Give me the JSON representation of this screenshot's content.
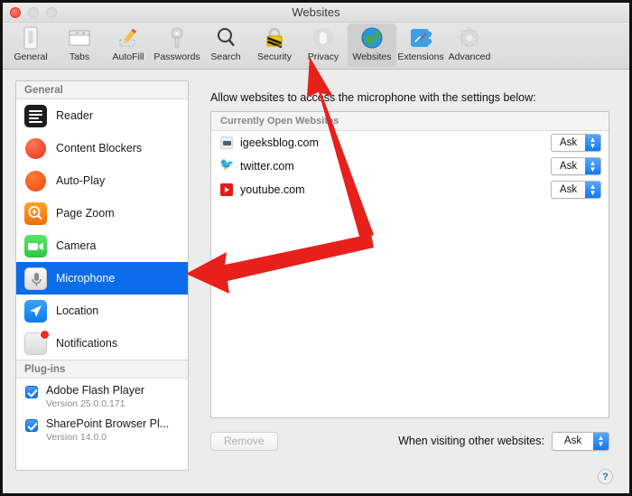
{
  "window": {
    "title": "Websites",
    "traffic_lights": [
      "close",
      "minimize",
      "maximize"
    ]
  },
  "toolbar": {
    "items": [
      {
        "label": "General",
        "icon": "general-icon",
        "selected": false
      },
      {
        "label": "Tabs",
        "icon": "tabs-icon",
        "selected": false
      },
      {
        "label": "AutoFill",
        "icon": "autofill-icon",
        "selected": false
      },
      {
        "label": "Passwords",
        "icon": "passwords-icon",
        "selected": false
      },
      {
        "label": "Search",
        "icon": "search-icon",
        "selected": false
      },
      {
        "label": "Security",
        "icon": "security-icon",
        "selected": false
      },
      {
        "label": "Privacy",
        "icon": "privacy-icon",
        "selected": false
      },
      {
        "label": "Websites",
        "icon": "websites-icon",
        "selected": true
      },
      {
        "label": "Extensions",
        "icon": "extensions-icon",
        "selected": false
      },
      {
        "label": "Advanced",
        "icon": "advanced-icon",
        "selected": false
      }
    ]
  },
  "sidebar": {
    "general_header": "General",
    "items": [
      {
        "label": "Reader",
        "icon": "reader-icon",
        "selected": false
      },
      {
        "label": "Content Blockers",
        "icon": "content-blockers-icon",
        "selected": false
      },
      {
        "label": "Auto-Play",
        "icon": "auto-play-icon",
        "selected": false
      },
      {
        "label": "Page Zoom",
        "icon": "page-zoom-icon",
        "selected": false
      },
      {
        "label": "Camera",
        "icon": "camera-icon",
        "selected": false
      },
      {
        "label": "Microphone",
        "icon": "microphone-icon",
        "selected": true
      },
      {
        "label": "Location",
        "icon": "location-icon",
        "selected": false
      },
      {
        "label": "Notifications",
        "icon": "notifications-icon",
        "selected": false
      }
    ],
    "plugins_header": "Plug-ins",
    "plugins": [
      {
        "name": "Adobe Flash Player",
        "version": "Version 25.0.0.171",
        "checked": true
      },
      {
        "name": "SharePoint Browser Pl...",
        "version": "Version 14.0.0",
        "checked": true
      }
    ]
  },
  "main": {
    "description": "Allow websites to access the microphone with the settings below:",
    "list_header": "Currently Open Websites",
    "websites": [
      {
        "name": "igeeksblog.com",
        "favicon": "igeeksblog-favicon",
        "permission": "Ask"
      },
      {
        "name": "twitter.com",
        "favicon": "twitter-favicon",
        "permission": "Ask"
      },
      {
        "name": "youtube.com",
        "favicon": "youtube-favicon",
        "permission": "Ask"
      }
    ],
    "remove_label": "Remove",
    "other_websites_label": "When visiting other websites:",
    "other_websites_value": "Ask",
    "help_label": "?"
  },
  "annotations": {
    "arrow_color": "#e8201b",
    "arrows": [
      {
        "name": "arrow-to-websites-tab",
        "points_to": "Websites"
      },
      {
        "name": "arrow-to-microphone",
        "points_to": "Microphone"
      }
    ]
  },
  "colors": {
    "selection_blue": "#0a6ce8",
    "accent_blue": "#1179f3",
    "window_bg": "#ececec"
  }
}
